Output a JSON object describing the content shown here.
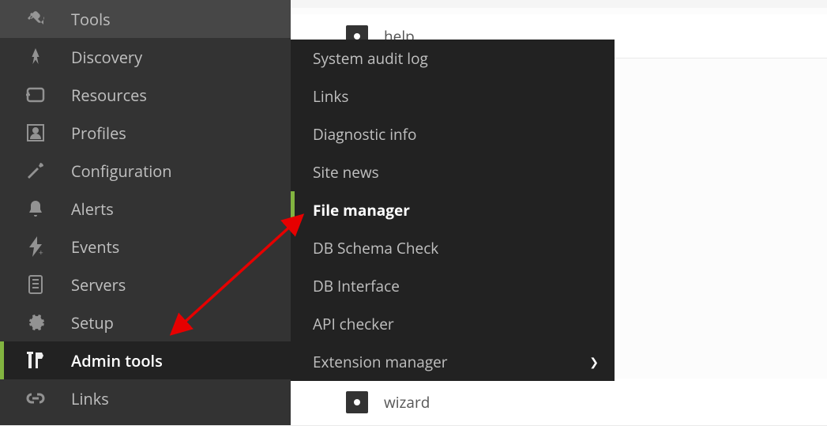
{
  "sidebar": {
    "items": [
      {
        "label": "Tools",
        "icon": "tools-icon"
      },
      {
        "label": "Discovery",
        "icon": "rocket-icon"
      },
      {
        "label": "Resources",
        "icon": "layers-icon"
      },
      {
        "label": "Profiles",
        "icon": "profile-icon"
      },
      {
        "label": "Configuration",
        "icon": "wrench-icon"
      },
      {
        "label": "Alerts",
        "icon": "bell-icon"
      },
      {
        "label": "Events",
        "icon": "bolt-icon"
      },
      {
        "label": "Servers",
        "icon": "server-icon"
      },
      {
        "label": "Setup",
        "icon": "gear-icon"
      },
      {
        "label": "Admin tools",
        "icon": "admin-tools-icon"
      },
      {
        "label": "Links",
        "icon": "link-icon"
      }
    ],
    "active_index": 9
  },
  "submenu": {
    "items": [
      {
        "label": "System audit log"
      },
      {
        "label": "Links"
      },
      {
        "label": "Diagnostic info"
      },
      {
        "label": "Site news"
      },
      {
        "label": "File manager"
      },
      {
        "label": "DB Schema Check"
      },
      {
        "label": "DB Interface"
      },
      {
        "label": "API checker"
      },
      {
        "label": "Extension manager",
        "has_children": true
      }
    ],
    "active_index": 4
  },
  "content": {
    "rows": [
      {
        "label": "help"
      },
      {
        "label": "wizard"
      }
    ]
  },
  "colors": {
    "accent": "#82b440",
    "sidebar_bg": "#333",
    "submenu_bg": "#222",
    "arrow": "#e60000"
  }
}
